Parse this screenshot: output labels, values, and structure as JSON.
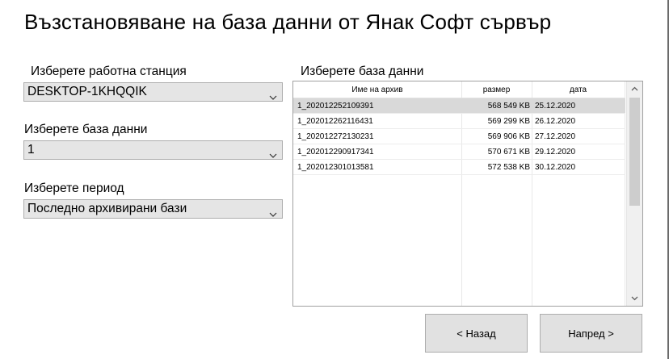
{
  "window": {
    "title": "Възстановяване на база данни от Янак Софт сървър"
  },
  "workstation": {
    "label": "Изберете работна станция",
    "value": "DESKTOP-1KHQQIK"
  },
  "database": {
    "label": "Изберете база данни",
    "value": "1"
  },
  "period": {
    "label": "Изберете период",
    "value": "Последно архивирани бази"
  },
  "list": {
    "label": "Изберете база данни",
    "columns": [
      "Име на архив",
      "размер",
      "дата"
    ],
    "rows": [
      {
        "name": "1_202012252109391",
        "size": "568 549 KB",
        "date": "25.12.2020",
        "selected": true
      },
      {
        "name": "1_202012262116431",
        "size": "569 299 KB",
        "date": "26.12.2020",
        "selected": false
      },
      {
        "name": "1_202012272130231",
        "size": "569 906 KB",
        "date": "27.12.2020",
        "selected": false
      },
      {
        "name": "1_202012290917341",
        "size": "570 671 KB",
        "date": "29.12.2020",
        "selected": false
      },
      {
        "name": "1_202012301013581",
        "size": "572 538 KB",
        "date": "30.12.2020",
        "selected": false
      }
    ]
  },
  "buttons": {
    "back": "< Назад",
    "next": "Напред >"
  },
  "icons": {
    "dropdown": "chevron-down-icon",
    "scroll_up": "scroll-up-arrow-icon",
    "scroll_down": "scroll-down-arrow-icon"
  }
}
